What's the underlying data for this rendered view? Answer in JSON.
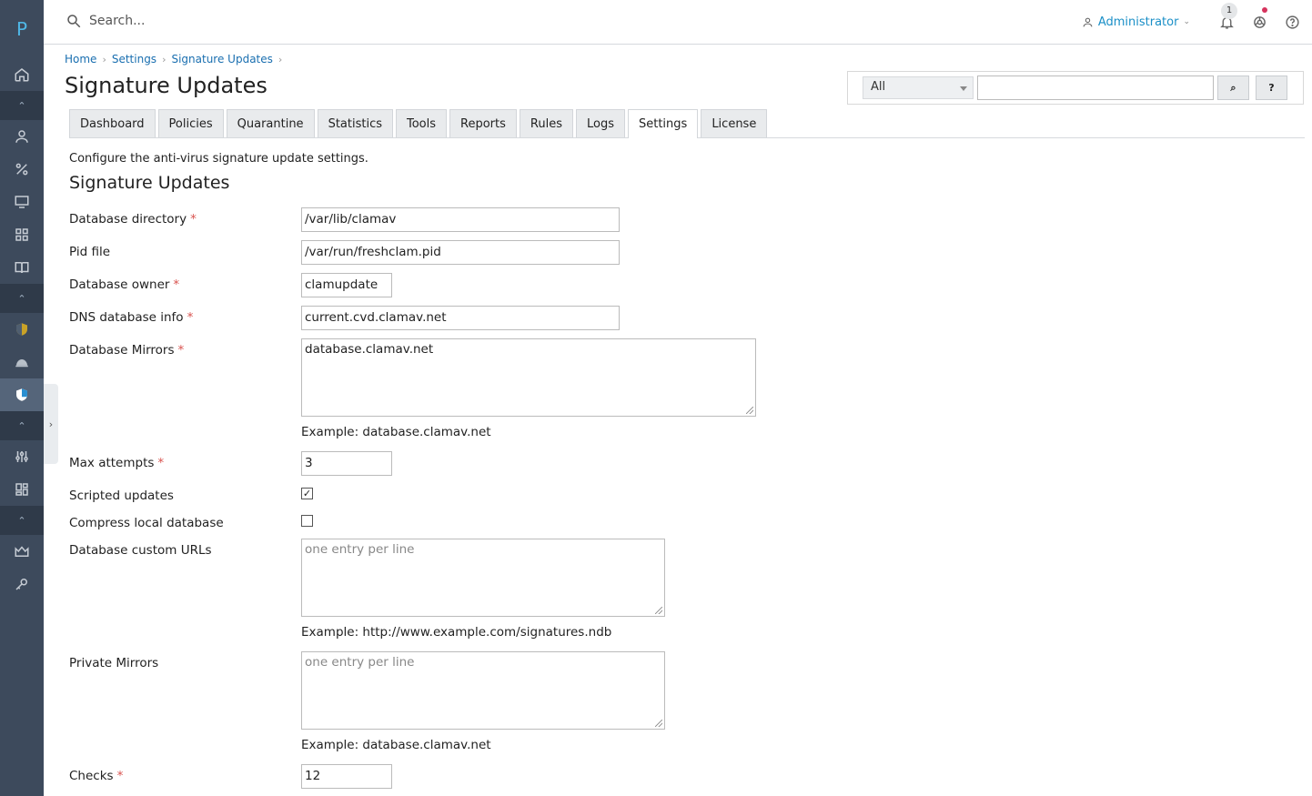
{
  "sidebar": {
    "logo": "P",
    "icons": [
      "home-icon",
      "user-icon",
      "percent-icon",
      "monitor-icon",
      "apps-icon",
      "book-icon",
      "shield-icon",
      "helmet-icon",
      "shield-check-icon",
      "sliders-icon",
      "layout-icon",
      "crown-icon",
      "key-icon"
    ]
  },
  "topbar": {
    "search_placeholder": "Search...",
    "user": "Administrator",
    "notifications_count": "1"
  },
  "breadcrumb": [
    "Home",
    "Settings",
    "Signature Updates"
  ],
  "page_title": "Signature Updates",
  "filter": {
    "select_value": "All",
    "search_button": "⌕",
    "help_button": "?"
  },
  "tabs": [
    {
      "label": "Dashboard"
    },
    {
      "label": "Policies"
    },
    {
      "label": "Quarantine"
    },
    {
      "label": "Statistics"
    },
    {
      "label": "Tools"
    },
    {
      "label": "Reports"
    },
    {
      "label": "Rules"
    },
    {
      "label": "Logs"
    },
    {
      "label": "Settings",
      "active": true
    },
    {
      "label": "License"
    }
  ],
  "description": "Configure the anti-virus signature update settings.",
  "section_title": "Signature Updates",
  "form": {
    "db_dir_label": "Database directory",
    "db_dir_value": "/var/lib/clamav",
    "pid_label": "Pid file",
    "pid_value": "/var/run/freshclam.pid",
    "owner_label": "Database owner",
    "owner_value": "clamupdate",
    "dns_label": "DNS database info",
    "dns_value": "current.cvd.clamav.net",
    "mirrors_label": "Database Mirrors",
    "mirrors_value": "database.clamav.net",
    "mirrors_hint": "Example: database.clamav.net",
    "max_attempts_label": "Max attempts",
    "max_attempts_value": "3",
    "scripted_label": "Scripted updates",
    "scripted_checked": true,
    "compress_label": "Compress local database",
    "compress_checked": false,
    "custom_urls_label": "Database custom URLs",
    "custom_urls_placeholder": "one entry per line",
    "custom_urls_hint": "Example: http://www.example.com/signatures.ndb",
    "private_label": "Private Mirrors",
    "private_placeholder": "one entry per line",
    "private_hint": "Example: database.clamav.net",
    "checks_label": "Checks",
    "checks_value": "12",
    "required_mark": "*",
    "check_mark": "✓"
  }
}
